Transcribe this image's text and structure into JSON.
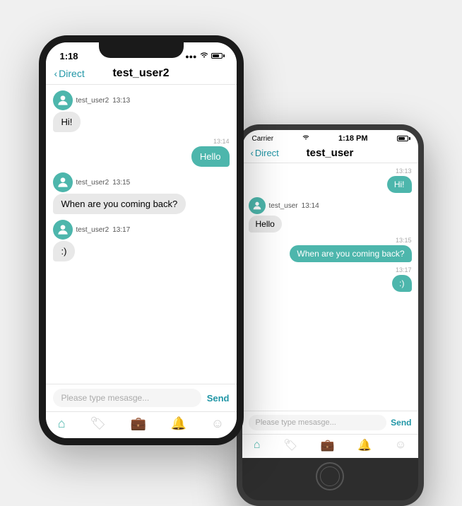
{
  "large_phone": {
    "status": {
      "time": "1:18",
      "signal": "●●●",
      "wifi": "wifi",
      "battery": "battery"
    },
    "nav": {
      "back_label": "Direct",
      "title": "test_user2"
    },
    "messages": [
      {
        "type": "incoming",
        "sender": "test_user2",
        "time": "13:13",
        "text": "Hi!"
      },
      {
        "type": "outgoing",
        "time_header": "13:14",
        "text": "Hello"
      },
      {
        "type": "incoming",
        "sender": "test_user2",
        "time": "13:15",
        "text": "When are you coming back?"
      },
      {
        "type": "incoming",
        "sender": "test_user2",
        "time": "13:17",
        "text": ":)"
      }
    ],
    "input": {
      "placeholder": "Please type mesasge...",
      "send_label": "Send"
    },
    "tabs": [
      "home",
      "tag",
      "bag",
      "bell",
      "face"
    ]
  },
  "small_phone": {
    "status": {
      "carrier": "Carrier",
      "wifi": "wifi",
      "time": "1:18 PM",
      "battery": "battery"
    },
    "nav": {
      "back_label": "Direct",
      "title": "test_user"
    },
    "messages": [
      {
        "type": "outgoing",
        "time_header": "13:13",
        "text": "Hi!"
      },
      {
        "type": "incoming",
        "sender": "test_user",
        "time": "13:14",
        "text": "Hello"
      },
      {
        "type": "outgoing",
        "time_header": "13:15",
        "text": "When are you coming back?"
      },
      {
        "type": "outgoing",
        "time_header": "13:17",
        "text": ":)"
      }
    ],
    "input": {
      "placeholder": "Please type mesasge...",
      "send_label": "Send"
    },
    "tabs": [
      "home",
      "tag",
      "bag",
      "bell",
      "face"
    ]
  }
}
